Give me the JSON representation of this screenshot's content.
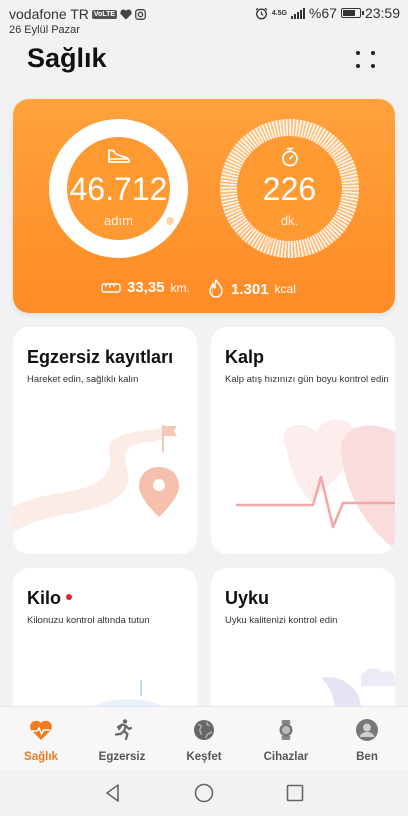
{
  "status_bar": {
    "carrier": "vodafone TR",
    "volte": "VoLTE",
    "date": "26 Eylül Pazar",
    "network": "4.5G",
    "battery": "%67",
    "time": "23:59"
  },
  "header": {
    "title": "Sağlık"
  },
  "summary": {
    "steps_value": "46.712",
    "steps_unit": "adım",
    "minutes_value": "226",
    "minutes_unit": "dk.",
    "distance_value": "33,35",
    "distance_unit": "km.",
    "calories_value": "1.301",
    "calories_unit": "kcal"
  },
  "cards": {
    "exercise": {
      "title": "Egzersiz kayıtları",
      "subtitle": "Hareket edin, sağlıklı kalın"
    },
    "heart": {
      "title": "Kalp",
      "subtitle": "Kalp atış hızınızı gün boyu kontrol edin"
    },
    "weight": {
      "title": "Kilo",
      "subtitle": "Kilonuzu kontrol altında tutun"
    },
    "sleep": {
      "title": "Uyku",
      "subtitle": "Uyku kalitenizi kontrol edin"
    }
  },
  "nav": {
    "items": [
      {
        "label": "Sağlık",
        "icon": "heart-rate-icon"
      },
      {
        "label": "Egzersiz",
        "icon": "running-icon"
      },
      {
        "label": "Keşfet",
        "icon": "globe-icon"
      },
      {
        "label": "Cihazlar",
        "icon": "watch-icon"
      },
      {
        "label": "Ben",
        "icon": "profile-icon"
      }
    ]
  },
  "colors": {
    "accent": "#f07a1c",
    "card_orange": "#ff9a32",
    "alert_dot": "#e8232f"
  }
}
